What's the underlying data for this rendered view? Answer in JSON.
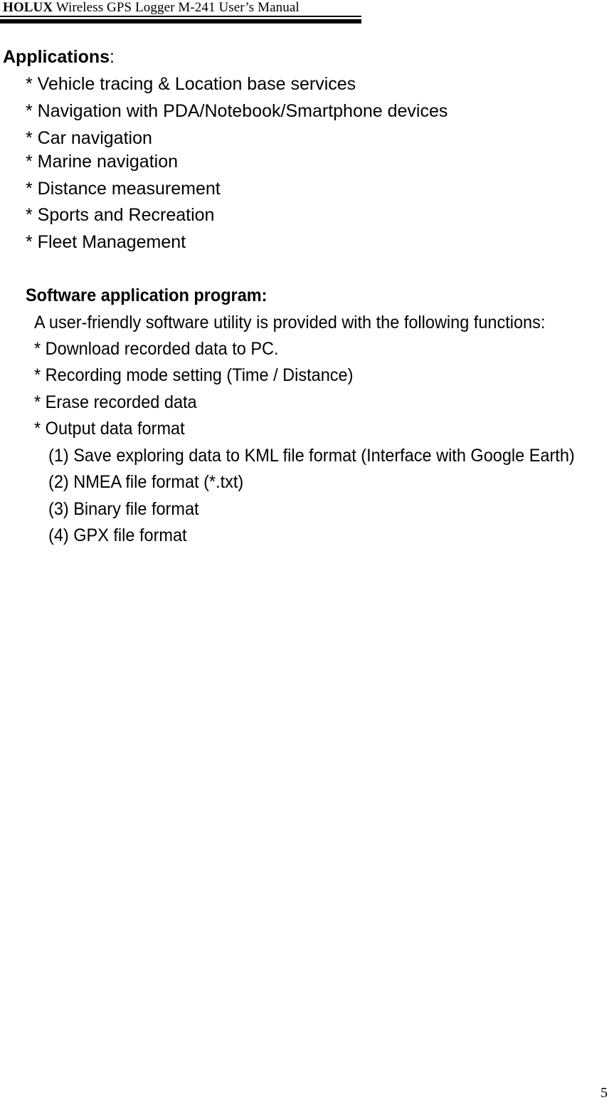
{
  "header": {
    "brand": "HOLUX",
    "title_rest": " Wireless GPS Logger M-241 User’s Manual"
  },
  "applications": {
    "heading": "Applications",
    "heading_punct": ":",
    "items": [
      "* Vehicle tracing & Location base services",
      "* Navigation with PDA/Notebook/Smartphone devices",
      "* Car navigation",
      "* Marine navigation",
      "* Distance measurement",
      "* Sports and Recreation",
      "* Fleet Management"
    ]
  },
  "software": {
    "heading": "Software application program:",
    "intro": "A user-friendly software utility is provided with the following functions:",
    "items": [
      "* Download recorded data to PC.",
      "* Recording mode setting (Time / Distance)",
      "* Erase recorded data",
      "* Output data format"
    ],
    "formats": [
      "(1) Save exploring data to KML file format (Interface with Google Earth)",
      "(2) NMEA file format (*.txt)",
      "(3) Binary file format",
      "(4) GPX file format"
    ]
  },
  "footer": {
    "page_number": "5"
  }
}
